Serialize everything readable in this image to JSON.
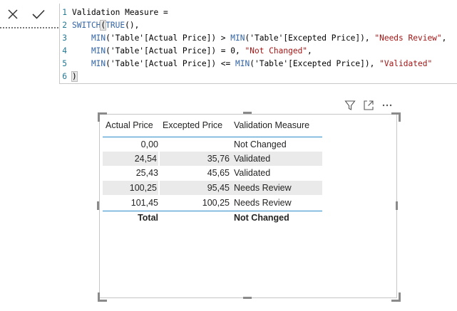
{
  "formula_bar": {
    "cancel_icon": "close-icon",
    "commit_icon": "check-icon",
    "lines": [
      {
        "num": "1",
        "tokens": [
          {
            "t": "Validation Measure =",
            "k": "plain"
          }
        ]
      },
      {
        "num": "2",
        "tokens": [
          {
            "t": "SWITCH",
            "k": "fn"
          },
          {
            "t": "(",
            "k": "paren-hl"
          },
          {
            "t": "TRUE",
            "k": "fn"
          },
          {
            "t": "(),",
            "k": "plain"
          }
        ]
      },
      {
        "num": "3",
        "tokens": [
          {
            "t": "    MIN",
            "k": "fn"
          },
          {
            "t": "('Table'[Actual Price]) > ",
            "k": "plain"
          },
          {
            "t": "MIN",
            "k": "fn"
          },
          {
            "t": "('Table'[Excepted Price]), ",
            "k": "plain"
          },
          {
            "t": "\"Needs Review\"",
            "k": "str"
          },
          {
            "t": ",",
            "k": "plain"
          }
        ]
      },
      {
        "num": "4",
        "tokens": [
          {
            "t": "    MIN",
            "k": "fn"
          },
          {
            "t": "('Table'[Actual Price]) = 0, ",
            "k": "plain"
          },
          {
            "t": "\"Not Changed\"",
            "k": "str"
          },
          {
            "t": ",",
            "k": "plain"
          }
        ]
      },
      {
        "num": "5",
        "tokens": [
          {
            "t": "    MIN",
            "k": "fn"
          },
          {
            "t": "('Table'[Actual Price]) <= ",
            "k": "plain"
          },
          {
            "t": "MIN",
            "k": "fn"
          },
          {
            "t": "('Table'[Excepted Price]), ",
            "k": "plain"
          },
          {
            "t": "\"Validated\"",
            "k": "str"
          }
        ]
      },
      {
        "num": "6",
        "tokens": [
          {
            "t": ")",
            "k": "paren-hl"
          }
        ]
      }
    ]
  },
  "visual_header": {
    "icons": [
      "filter-icon",
      "focus-mode-icon",
      "more-options-icon"
    ]
  },
  "table": {
    "headers": [
      "Actual Price",
      "Excepted Price",
      "Validation Measure"
    ],
    "rows": [
      [
        "0,00",
        "",
        "Not Changed"
      ],
      [
        "24,54",
        "35,76",
        "Validated"
      ],
      [
        "25,43",
        "45,65",
        "Validated"
      ],
      [
        "100,25",
        "95,45",
        "Needs Review"
      ],
      [
        "101,45",
        "100,25",
        "Needs Review"
      ]
    ],
    "total": [
      "Total",
      "",
      "Not Changed"
    ]
  },
  "colors": {
    "accent_line": "#2e8bc9",
    "row_shade": "#eaeaea",
    "code_function": "#3465a4",
    "code_string": "#a31515",
    "line_number": "#237893"
  }
}
